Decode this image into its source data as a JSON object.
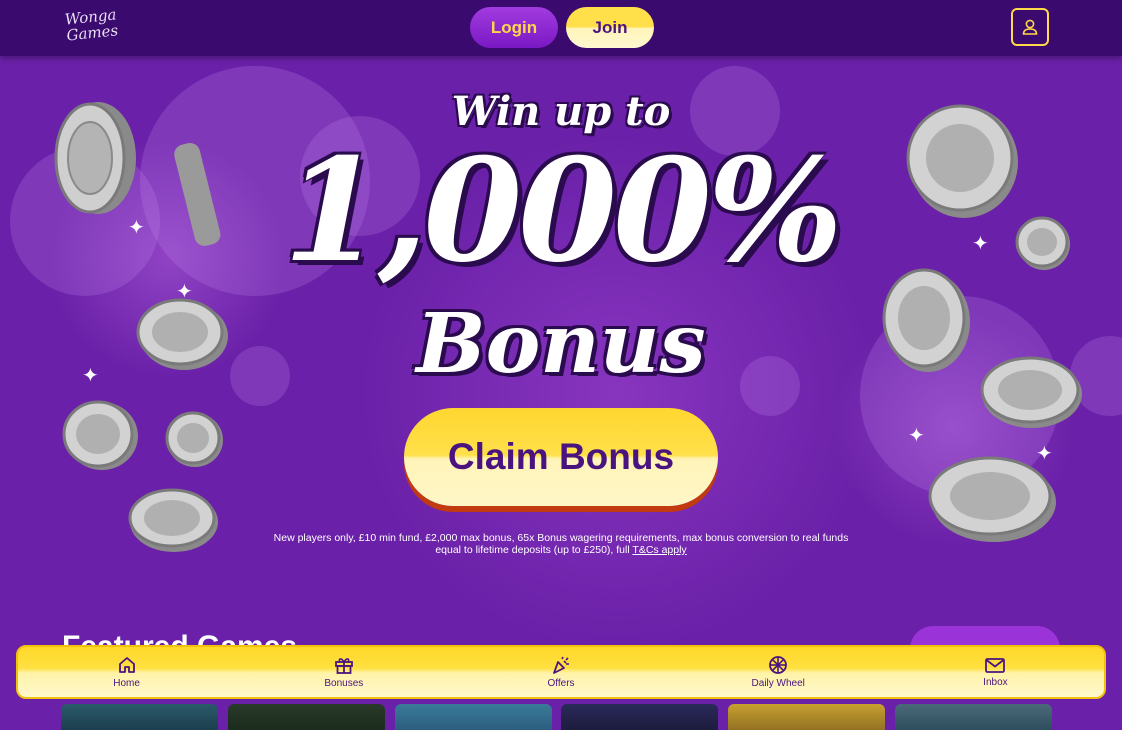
{
  "brand": {
    "logo_line1": "Wonga",
    "logo_line2": "Games"
  },
  "header": {
    "login_label": "Login",
    "join_label": "Join",
    "account_icon": "user-icon"
  },
  "hero": {
    "headline_small": "Win up to",
    "headline_big": "1,000%",
    "headline_bonus": "Bonus",
    "claim_label": "Claim Bonus",
    "terms_text": "New players only, £10 min fund, £2,000 max bonus, 65x Bonus wagering requirements, max bonus conversion to real funds equal to lifetime deposits (up to £250), full ",
    "terms_link": "T&Cs apply"
  },
  "featured": {
    "title": "Featured Games"
  },
  "bottom_nav": {
    "items": [
      {
        "label": "Home",
        "icon": "home-icon"
      },
      {
        "label": "Bonuses",
        "icon": "gift-icon"
      },
      {
        "label": "Offers",
        "icon": "party-popper-icon"
      },
      {
        "label": "Daily Wheel",
        "icon": "wheel-icon"
      },
      {
        "label": "Inbox",
        "icon": "mail-icon"
      }
    ]
  },
  "colors": {
    "header_bg": "#3a0a6e",
    "hero_bg": "#6a20a8",
    "accent_yellow": "#ffe04a",
    "accent_purple": "#4a1480",
    "button_shadow": "#c23a10"
  }
}
